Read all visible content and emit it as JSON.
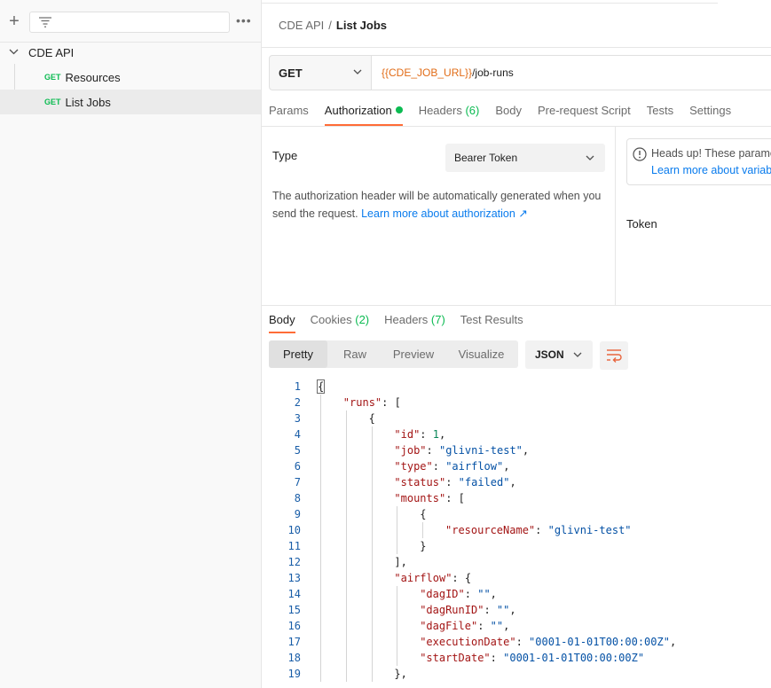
{
  "sidebar": {
    "collection": "CDE API",
    "requests": [
      {
        "method": "GET",
        "name": "Resources"
      },
      {
        "method": "GET",
        "name": "List Jobs"
      }
    ]
  },
  "breadcrumb": {
    "parent": "CDE API",
    "separator": "/",
    "current": "List Jobs"
  },
  "request": {
    "method": "GET",
    "url_var": "{{CDE_JOB_URL}}",
    "url_path": "/job-runs",
    "tabs": [
      "Params",
      "Authorization",
      "Headers",
      "Body",
      "Pre-request Script",
      "Tests",
      "Settings"
    ],
    "headers_count": "(6)"
  },
  "auth": {
    "type_label": "Type",
    "type_value": "Bearer Token",
    "desc": "The authorization header will be automatically generated when you send the request.",
    "desc_link": "Learn more about authorization ↗",
    "headsup_title": "Heads up! These parameters",
    "headsup_link": "Learn more about variables",
    "token_label": "Token"
  },
  "response": {
    "tabs": [
      "Body",
      "Cookies",
      "Headers",
      "Test Results"
    ],
    "cookies_count": "(2)",
    "headers_count": "(7)",
    "views": [
      "Pretty",
      "Raw",
      "Preview",
      "Visualize"
    ],
    "format": "JSON"
  },
  "code": [
    {
      "n": "1",
      "indent": 0,
      "tokens": [
        [
          "p",
          "{"
        ]
      ]
    },
    {
      "n": "2",
      "indent": 1,
      "tokens": [
        [
          "k",
          "\"runs\""
        ],
        [
          "p",
          ": ["
        ]
      ]
    },
    {
      "n": "3",
      "indent": 2,
      "tokens": [
        [
          "p",
          "{"
        ]
      ]
    },
    {
      "n": "4",
      "indent": 3,
      "tokens": [
        [
          "k",
          "\"id\""
        ],
        [
          "p",
          ": "
        ],
        [
          "n",
          "1"
        ],
        [
          "p",
          ","
        ]
      ]
    },
    {
      "n": "5",
      "indent": 3,
      "tokens": [
        [
          "k",
          "\"job\""
        ],
        [
          "p",
          ": "
        ],
        [
          "s",
          "\"glivni-test\""
        ],
        [
          "p",
          ","
        ]
      ]
    },
    {
      "n": "6",
      "indent": 3,
      "tokens": [
        [
          "k",
          "\"type\""
        ],
        [
          "p",
          ": "
        ],
        [
          "s",
          "\"airflow\""
        ],
        [
          "p",
          ","
        ]
      ]
    },
    {
      "n": "7",
      "indent": 3,
      "tokens": [
        [
          "k",
          "\"status\""
        ],
        [
          "p",
          ": "
        ],
        [
          "s",
          "\"failed\""
        ],
        [
          "p",
          ","
        ]
      ]
    },
    {
      "n": "8",
      "indent": 3,
      "tokens": [
        [
          "k",
          "\"mounts\""
        ],
        [
          "p",
          ": ["
        ]
      ]
    },
    {
      "n": "9",
      "indent": 4,
      "tokens": [
        [
          "p",
          "{"
        ]
      ]
    },
    {
      "n": "10",
      "indent": 5,
      "tokens": [
        [
          "k",
          "\"resourceName\""
        ],
        [
          "p",
          ": "
        ],
        [
          "s",
          "\"glivni-test\""
        ]
      ]
    },
    {
      "n": "11",
      "indent": 4,
      "tokens": [
        [
          "p",
          "}"
        ]
      ]
    },
    {
      "n": "12",
      "indent": 3,
      "tokens": [
        [
          "p",
          "],"
        ]
      ]
    },
    {
      "n": "13",
      "indent": 3,
      "tokens": [
        [
          "k",
          "\"airflow\""
        ],
        [
          "p",
          ": {"
        ]
      ]
    },
    {
      "n": "14",
      "indent": 4,
      "tokens": [
        [
          "k",
          "\"dagID\""
        ],
        [
          "p",
          ": "
        ],
        [
          "s",
          "\"\""
        ],
        [
          "p",
          ","
        ]
      ]
    },
    {
      "n": "15",
      "indent": 4,
      "tokens": [
        [
          "k",
          "\"dagRunID\""
        ],
        [
          "p",
          ": "
        ],
        [
          "s",
          "\"\""
        ],
        [
          "p",
          ","
        ]
      ]
    },
    {
      "n": "16",
      "indent": 4,
      "tokens": [
        [
          "k",
          "\"dagFile\""
        ],
        [
          "p",
          ": "
        ],
        [
          "s",
          "\"\""
        ],
        [
          "p",
          ","
        ]
      ]
    },
    {
      "n": "17",
      "indent": 4,
      "tokens": [
        [
          "k",
          "\"executionDate\""
        ],
        [
          "p",
          ": "
        ],
        [
          "s",
          "\"0001-01-01T00:00:00Z\""
        ],
        [
          "p",
          ","
        ]
      ]
    },
    {
      "n": "18",
      "indent": 4,
      "tokens": [
        [
          "k",
          "\"startDate\""
        ],
        [
          "p",
          ": "
        ],
        [
          "s",
          "\"0001-01-01T00:00:00Z\""
        ]
      ]
    },
    {
      "n": "19",
      "indent": 3,
      "tokens": [
        [
          "p",
          "},"
        ]
      ]
    }
  ]
}
